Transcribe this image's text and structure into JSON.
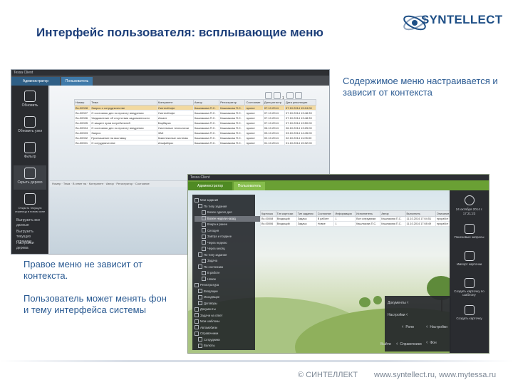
{
  "header": {
    "title": "Интерфейс пользователя: всплывающие меню",
    "logo_text": "SYNTELLECT"
  },
  "notes": {
    "context_menu": "Содержимое меню настраивается и зависит от контекста",
    "right_menu": "Правое меню не зависит от контекста.\n\nПользователь может менять фон и тему интерфейса системы"
  },
  "footer": {
    "company": "© СИНТЕЛЛЕКТ",
    "sites": "www.syntellect.ru, www.mytessa.ru"
  },
  "colors": {
    "title_blue": "#1d3f7a",
    "note_blue": "#2a5a92",
    "logo_blue": "#1e4f86",
    "tab_green": "#6aa034",
    "tab_blue": "#3f7aa9"
  },
  "screen1": {
    "window_title": "Tessa Client",
    "tabs": [
      "Администратор",
      "Пользователь"
    ],
    "left_menu": [
      {
        "label": "Обновить",
        "icon": "refresh-icon"
      },
      {
        "label": "Обновить узел",
        "icon": "refresh-node-icon"
      },
      {
        "label": "Фильтр",
        "icon": "filter-icon"
      },
      {
        "label": "Скрыть дерево",
        "icon": "hide-tree-icon"
      },
      {
        "label": "Открыть текущую страницу в новом окне",
        "icon": "open-window-icon"
      }
    ],
    "left_small": [
      "Выгрузить все данные",
      "Выгрузить текущую страницу",
      "Настройки дерева"
    ],
    "page_number": "1",
    "columns": [
      "Номер",
      "Тема",
      "Контрагент",
      "Автор",
      "Регистратор",
      "Состояние",
      "Дата регистр",
      "Дата резолюции"
    ],
    "rows": [
      [
        "Вх-00008",
        "Запрос о сотрудничестве",
        "СинтелКофе",
        "Кашлакова П.С.",
        "Кашлакова П.С.",
        "проект",
        "07.10.2014",
        "07.10.2014 15:24:00"
      ],
      [
        "Вх-00007",
        "О состоянии дел по проекту внедрения",
        "СинтелКофе",
        "Кашлакова П.С.",
        "Кашлакова П.С.",
        "проект",
        "07.10.2014",
        "07.10.2014 13:48:39"
      ],
      [
        "Вх-00006",
        "Уведомление об отсутствии задолженности",
        "Аткант",
        "Кашлакова П.С.",
        "Кашлакова П.С.",
        "проект",
        "07.10.2014",
        "07.10.2014 13:48:39"
      ],
      [
        "Вх-00005",
        "О защите прав потребителей",
        "Барбарис",
        "Кашлакова П.С.",
        "Кашлакова П.С.",
        "проект",
        "07.10.2014",
        "07.10.2014 13:50:00"
      ],
      [
        "Вх-00004",
        "О состоянии дел по проекту внедрения",
        "Системные технологии",
        "Кашлакова П.С.",
        "Кашлакова П.С.",
        "проект",
        "06.10.2014",
        "06.10.2014 13:25:00"
      ],
      [
        "Вх-00003",
        "Запрос",
        "ЗАК",
        "Кашлакова П.С.",
        "Кашлакова П.С.",
        "проект",
        "03.10.2014",
        "03.10.2014 14:45:00"
      ],
      [
        "Вх-00002",
        "Приглашение на выставку",
        "Комплексные системы",
        "Кашлакова П.С.",
        "Кашлакова П.С.",
        "проект",
        "02.10.2014",
        "02.10.2014 11:05:00"
      ],
      [
        "Вх-00001",
        "О сотрудничестве",
        "АльфаКрос",
        "Кашлакова П.С.",
        "Кашлакова П.С.",
        "проект",
        "01.10.2014",
        "01.10.2014 15:32:00"
      ]
    ],
    "statusbar": "Номер · Тема · В ответ на · Контрагент · Автор · Регистратор · Состояние"
  },
  "screen2": {
    "window_title": "Tessa Client",
    "tabs": [
      "Администратор",
      "Пользователь"
    ],
    "tree": [
      {
        "label": "Мои задания",
        "indent": 0,
        "selected": false
      },
      {
        "label": "По типу задания",
        "indent": 1,
        "selected": false
      },
      {
        "label": "Более одного дня",
        "indent": 2,
        "selected": false
      },
      {
        "label": "Более недели назад",
        "indent": 2,
        "selected": true
      },
      {
        "label": "Вчера и ранее",
        "indent": 2,
        "selected": false
      },
      {
        "label": "Сегодня",
        "indent": 2,
        "selected": false
      },
      {
        "label": "Завтра и позднее",
        "indent": 2,
        "selected": false
      },
      {
        "label": "Через неделю",
        "indent": 2,
        "selected": false
      },
      {
        "label": "Через месяц",
        "indent": 2,
        "selected": false
      },
      {
        "label": "По типу задания",
        "indent": 1,
        "selected": false
      },
      {
        "label": "Задача",
        "indent": 2,
        "selected": false
      },
      {
        "label": "По состоянию",
        "indent": 1,
        "selected": false
      },
      {
        "label": "В работе",
        "indent": 2,
        "selected": false
      },
      {
        "label": "Новое",
        "indent": 2,
        "selected": false
      },
      {
        "label": "Регистратура",
        "indent": 0,
        "selected": false
      },
      {
        "label": "Входящие",
        "indent": 1,
        "selected": false
      },
      {
        "label": "Исходящие",
        "indent": 1,
        "selected": false
      },
      {
        "label": "Договоры",
        "indent": 1,
        "selected": false
      },
      {
        "label": "Документы",
        "indent": 0,
        "selected": false
      },
      {
        "label": "Задачи на ответ",
        "indent": 0,
        "selected": false
      },
      {
        "label": "Мои шаблоны",
        "indent": 0,
        "selected": false
      },
      {
        "label": "Автомобили",
        "indent": 0,
        "selected": false
      },
      {
        "label": "Справочники",
        "indent": 0,
        "selected": false
      },
      {
        "label": "Сотрудники",
        "indent": 1,
        "selected": false
      },
      {
        "label": "Валюты",
        "indent": 1,
        "selected": false
      }
    ],
    "columns": [
      "Карточка",
      "Тип карточки",
      "Тип задания",
      "Состояние",
      "Информация",
      "Исполнитель",
      "Автор",
      "Выполнить",
      "Описание"
    ],
    "rows": [
      [
        "Вх-00008",
        "Входящий",
        "Задача",
        "В работе",
        "1",
        "Все сотрудники",
        "Кашлакова П.С.",
        "11.10.2014 17:04:51",
        "проработ"
      ],
      [
        "Вх-00006",
        "Входящий",
        "Задача",
        "Новое",
        "1",
        "Кашлакова П.С.",
        "Кашлакова П.С.",
        "11.10.2014 17:08:49",
        "проработ"
      ]
    ],
    "right_menu": [
      {
        "label": "",
        "icon": "help-icon"
      },
      {
        "label": "Поисковые запросы",
        "icon": "search-queries-icon"
      },
      {
        "label": "Импорт карточки",
        "icon": "import-card-icon"
      },
      {
        "label": "Создать карточку по шаблону",
        "icon": "template-card-icon"
      },
      {
        "label": "Создать карточку",
        "icon": "create-card-icon"
      }
    ],
    "date_widget": "24 октября 2014 г.\n17:21:23",
    "popup_menu": [
      {
        "label": "Документы",
        "side": "left"
      },
      {
        "label": "Настройки",
        "side": "left"
      },
      {
        "label": "Роли",
        "side": "left"
      },
      {
        "label": "Настройки",
        "side": "right"
      },
      {
        "label": "Выйти",
        "side": "bottom-left"
      },
      {
        "label": "Справочники",
        "side": "bottom-mid"
      },
      {
        "label": "Фон",
        "side": "bottom-right"
      }
    ]
  }
}
